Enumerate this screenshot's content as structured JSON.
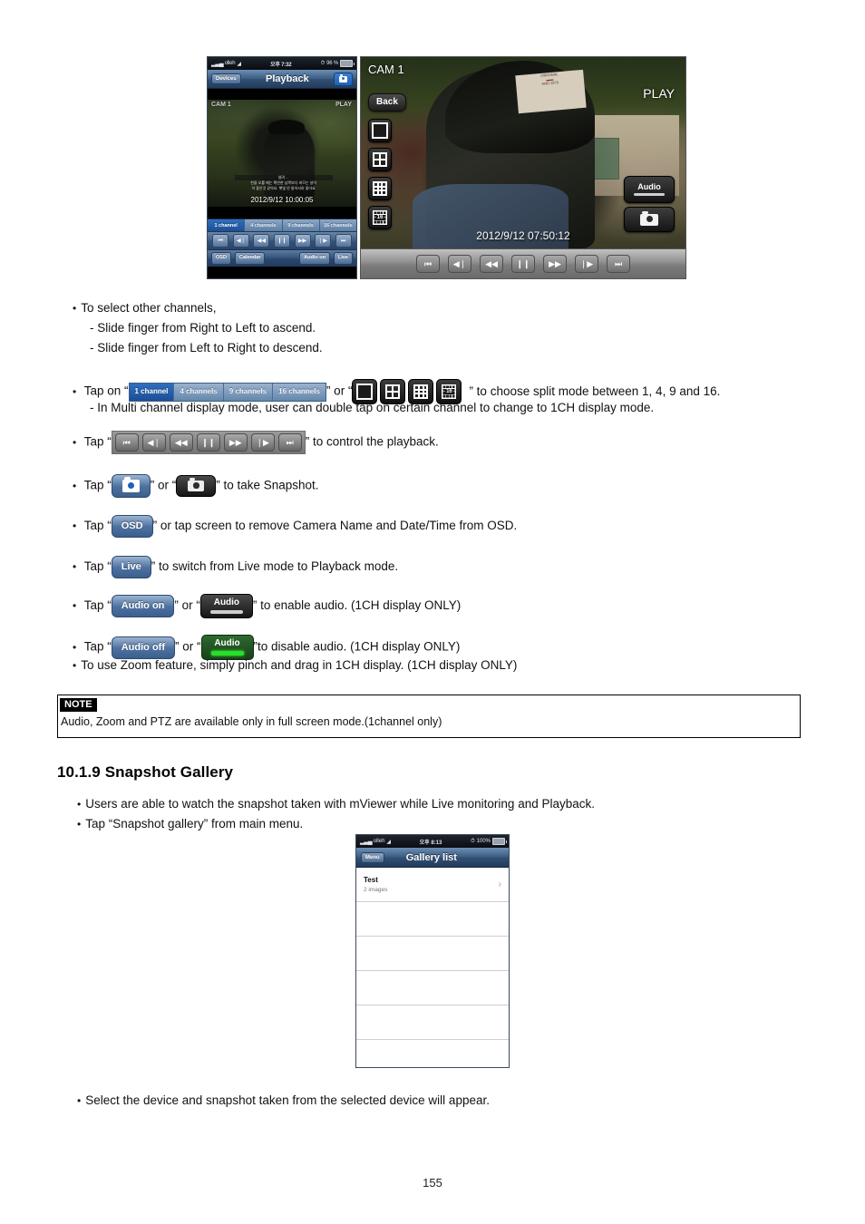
{
  "page": {
    "number": "155"
  },
  "figure_playback_phone": {
    "statusbar": {
      "carrier": "olleh",
      "signal_icon": "signal-bars-icon",
      "wifi_icon": "wifi-icon",
      "time": "오후 7:32",
      "alarm_icon": "alarm-icon",
      "battery_percent": "96 %",
      "battery_icon": "battery-icon"
    },
    "navbar": {
      "back_label": "Devices",
      "title": "Playback",
      "snapshot_icon": "camera-icon"
    },
    "video": {
      "camera_name": "CAM 1",
      "status": "PLAY",
      "subtitle_line1": "살려 ...",
      "subtitle_line2": "천을 오를 때는 확연한 남짝보다 비므는 날이",
      "subtitle_line3": "이 좋은것 같아요. 햇빛 안 들어서야 좋아요",
      "timestamp": "2012/9/12 10:00:05"
    },
    "channel_tabs": [
      {
        "label": "1 channel",
        "active": true
      },
      {
        "label": "4 channels",
        "active": false
      },
      {
        "label": "9 channels",
        "active": false
      },
      {
        "label": "16 channels",
        "active": false
      }
    ],
    "transport_buttons": [
      {
        "name": "skip-to-start",
        "glyph": "⏮"
      },
      {
        "name": "step-backward",
        "glyph": "◀❘"
      },
      {
        "name": "rewind",
        "glyph": "◀◀"
      },
      {
        "name": "pause",
        "glyph": "❙❙"
      },
      {
        "name": "fast-forward",
        "glyph": "▶▶"
      },
      {
        "name": "step-forward",
        "glyph": "❘▶"
      },
      {
        "name": "skip-to-end",
        "glyph": "⏭"
      }
    ],
    "bottom_buttons": {
      "osd": "OSD",
      "calendar": "Calendar",
      "audio": "Audio on",
      "live": "Live"
    }
  },
  "figure_fullscreen_panel": {
    "camera_name": "CAM 1",
    "status": "PLAY",
    "back_label": "Back",
    "split_buttons": [
      {
        "name": "split-1",
        "label": ""
      },
      {
        "name": "split-4",
        "label": ""
      },
      {
        "name": "split-9",
        "label": ""
      },
      {
        "name": "split-16",
        "label": "16"
      }
    ],
    "audio_label": "Audio",
    "snapshot_icon": "camera-icon",
    "timestamp": "2012/9/12 07:50:12",
    "transport_buttons": [
      {
        "name": "skip-to-start",
        "glyph": "⏮"
      },
      {
        "name": "step-backward",
        "glyph": "◀❘"
      },
      {
        "name": "rewind",
        "glyph": "◀◀"
      },
      {
        "name": "pause",
        "glyph": "❙❙"
      },
      {
        "name": "fast-forward",
        "glyph": "▶▶"
      },
      {
        "name": "step-forward",
        "glyph": "❘▶"
      },
      {
        "name": "skip-to-end",
        "glyph": "⏭"
      }
    ]
  },
  "body": {
    "b1": "To select other channels,",
    "b1_d1": "-  Slide finger from Right to Left to ascend.",
    "b1_d2": "-  Slide finger from Left to Right to descend.",
    "b2_pre": "Tap on “",
    "b2_mid": "” or “",
    "b2_post": "” to choose split mode between 1, 4, 9 and 16.",
    "b2_d1": "-   In Multi channel display mode, user can double tap on certain channel to change to 1CH display mode.",
    "b3_pre": "Tap “",
    "b3_post": "” to control the playback.",
    "b4_pre": "Tap “",
    "b4_mid": "” or “",
    "b4_post": "” to take Snapshot.",
    "b5_pre": "Tap “",
    "b5_post": "” or tap screen to remove Camera Name and Date/Time from OSD.",
    "b6_pre": "Tap “",
    "b6_post": "” to switch from Live mode to Playback mode.",
    "b7_pre": "Tap “",
    "b7_mid": "” or “",
    "b7_post": "” to enable audio. (1CH display ONLY)",
    "b8_pre": "Tap “",
    "b8_mid": "” or “",
    "b8_post": "”to disable audio. (1CH display ONLY)",
    "b9": "To use Zoom feature, simply pinch and drag in 1CH display. (1CH display ONLY)",
    "inline_buttons": {
      "osd": "OSD",
      "live": "Live",
      "audio_on": "Audio on",
      "audio_off": "Audio off",
      "audio_dark": "Audio",
      "audio_green": "Audio",
      "split16": "16"
    }
  },
  "note": {
    "tag": "NOTE",
    "text": "Audio, Zoom and PTZ are available only in full screen mode.(1channel only)"
  },
  "section": {
    "heading": "10.1.9  Snapshot Gallery",
    "b1": "Users are able to watch the snapshot taken with mViewer while Live monitoring and Playback.",
    "b2": "Tap “Snapshot gallery” from main menu.",
    "b3": "Select the device and snapshot taken from the selected device will appear."
  },
  "figure_gallery_phone": {
    "statusbar": {
      "carrier": "olleh",
      "time": "오후 8:13",
      "battery_percent": "100%"
    },
    "navbar": {
      "menu_label": "Menu",
      "title": "Gallery list"
    },
    "rows": [
      {
        "title": "Test",
        "subtitle": "2 images",
        "chevron": "›"
      },
      {
        "title": "",
        "subtitle": "",
        "chevron": ""
      },
      {
        "title": "",
        "subtitle": "",
        "chevron": ""
      },
      {
        "title": "",
        "subtitle": "",
        "chevron": ""
      },
      {
        "title": "",
        "subtitle": "",
        "chevron": ""
      },
      {
        "title": "",
        "subtitle": "",
        "chevron": ""
      }
    ]
  }
}
